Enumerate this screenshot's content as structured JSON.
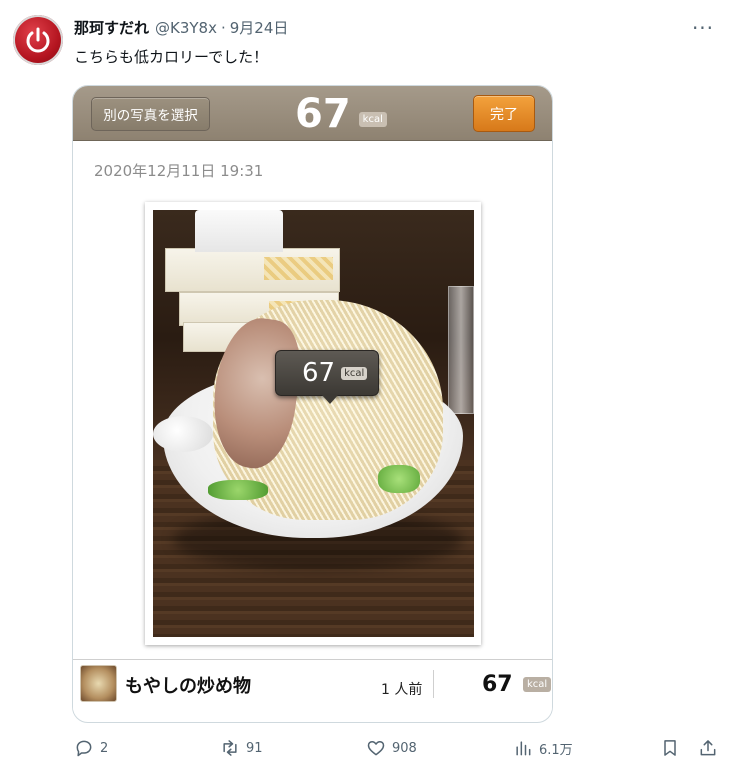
{
  "tweet": {
    "display_name": "那珂すだれ",
    "handle": "@K3Y8x",
    "separator": "·",
    "date": "9月24日",
    "more_icon": "more-icon",
    "more_glyph": "···",
    "text": "こちらも低カロリーでした！"
  },
  "app": {
    "choose_photo_label": "別の写真を選択",
    "total_kcal": "67",
    "kcal_unit": "kcal",
    "done_label": "完了",
    "photo_date": "2020年12月11日 19:31",
    "bubble_kcal": "67",
    "bubble_unit": "kcal"
  },
  "food": {
    "name": "もやしの炒め物",
    "serving": "1 人前",
    "kcal": "67",
    "unit": "kcal"
  },
  "actions": {
    "replies": "2",
    "retweets": "91",
    "likes": "908",
    "views": "6.1万"
  },
  "colors": {
    "app_bar": "#9a8e7d",
    "done_button": "#e88c28",
    "text_muted": "#536471"
  }
}
